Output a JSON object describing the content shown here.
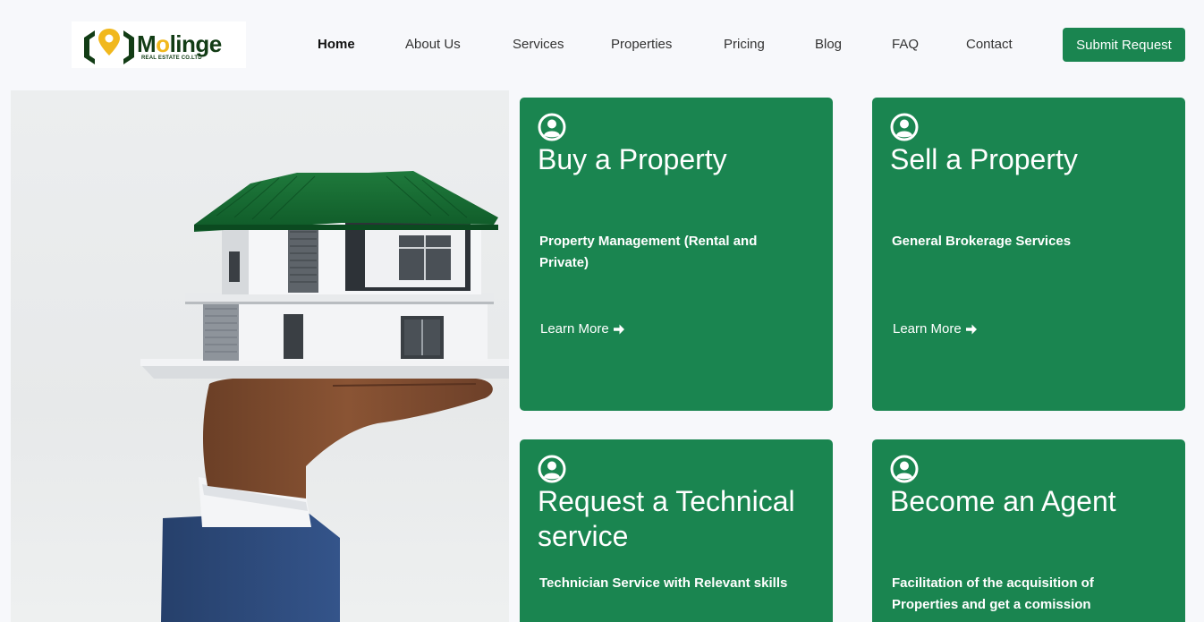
{
  "brand": {
    "name_part1": "M",
    "name_o": "o",
    "name_part2": "linge",
    "tagline": "REAL ESTATE CO.LTD",
    "logo_icon": "house-location-pin-icon",
    "colors": {
      "primary": "#1a8550",
      "dark_green": "#123c15",
      "accent_yellow": "#f1b81d"
    }
  },
  "nav": {
    "items": [
      {
        "label": "Home",
        "active": true
      },
      {
        "label": "About Us"
      },
      {
        "label": "Services"
      },
      {
        "label": "Properties"
      },
      {
        "label": "Pricing"
      },
      {
        "label": "Blog"
      },
      {
        "label": "FAQ"
      },
      {
        "label": "Contact"
      }
    ],
    "cta_label": "Submit Request"
  },
  "hero": {
    "image": "hand-holding-model-house-photo"
  },
  "cards": [
    {
      "icon": "user-circle-icon",
      "title": "Buy a Property",
      "description": "Property Management (Rental and Private)",
      "link_label": "Learn More",
      "link_icon": "arrow-right-icon"
    },
    {
      "icon": "user-circle-icon",
      "title": "Sell a Property",
      "description": "General Brokerage Services",
      "link_label": "Learn More",
      "link_icon": "arrow-right-icon"
    },
    {
      "icon": "user-circle-icon",
      "title": "Request a Technical service",
      "description": "Technician Service with Relevant skills"
    },
    {
      "icon": "user-circle-icon",
      "title": "Become an Agent",
      "description": "Facilitation of the acquisition of Properties and get a comission"
    }
  ]
}
